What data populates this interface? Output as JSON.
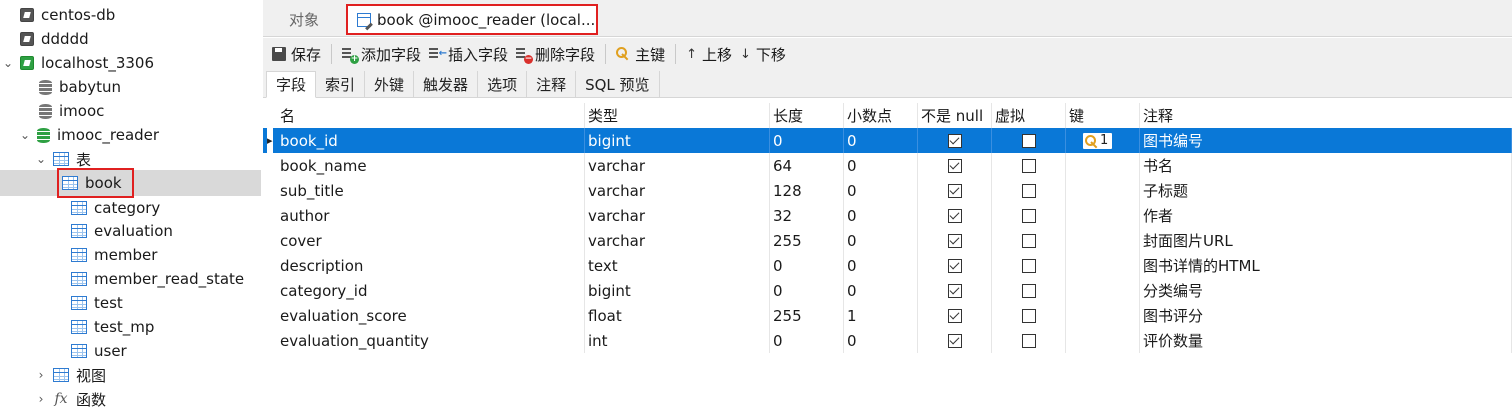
{
  "sidebar": {
    "items": [
      {
        "label": "centos-db",
        "icon": "connection-icon"
      },
      {
        "label": "ddddd",
        "icon": "connection-icon"
      },
      {
        "label": "localhost_3306",
        "icon": "connection-icon",
        "expanded": true
      },
      {
        "label": "babytun",
        "icon": "database-icon"
      },
      {
        "label": "imooc",
        "icon": "database-icon"
      },
      {
        "label": "imooc_reader",
        "icon": "database-icon",
        "expanded": true
      },
      {
        "label": "表",
        "icon": "tables-folder-icon",
        "expanded": true
      },
      {
        "label": "book",
        "icon": "table-icon",
        "selected": true
      },
      {
        "label": "category",
        "icon": "table-icon"
      },
      {
        "label": "evaluation",
        "icon": "table-icon"
      },
      {
        "label": "member",
        "icon": "table-icon"
      },
      {
        "label": "member_read_state",
        "icon": "table-icon"
      },
      {
        "label": "test",
        "icon": "table-icon"
      },
      {
        "label": "test_mp",
        "icon": "table-icon"
      },
      {
        "label": "user",
        "icon": "table-icon"
      },
      {
        "label": "视图",
        "icon": "views-folder-icon"
      },
      {
        "label": "函数",
        "icon": "functions-folder-icon"
      }
    ]
  },
  "tabs": {
    "objects": "对象",
    "active": "book @imooc_reader (local..."
  },
  "toolbar": {
    "save": "保存",
    "add_field": "添加字段",
    "insert_field": "插入字段",
    "delete_field": "删除字段",
    "primary_key": "主键",
    "move_up": "上移",
    "move_down": "下移"
  },
  "subtabs": [
    "字段",
    "索引",
    "外键",
    "触发器",
    "选项",
    "注释",
    "SQL 预览"
  ],
  "grid": {
    "columns": [
      "名",
      "类型",
      "长度",
      "小数点",
      "不是 null",
      "虚拟",
      "键",
      "注释"
    ],
    "key_badge": "1",
    "rows": [
      {
        "name": "book_id",
        "type": "bigint",
        "length": "0",
        "decimals": "0",
        "not_null": true,
        "virtual": false,
        "key": true,
        "comment": "图书编号"
      },
      {
        "name": "book_name",
        "type": "varchar",
        "length": "64",
        "decimals": "0",
        "not_null": true,
        "virtual": false,
        "key": false,
        "comment": "书名"
      },
      {
        "name": "sub_title",
        "type": "varchar",
        "length": "128",
        "decimals": "0",
        "not_null": true,
        "virtual": false,
        "key": false,
        "comment": "子标题"
      },
      {
        "name": "author",
        "type": "varchar",
        "length": "32",
        "decimals": "0",
        "not_null": true,
        "virtual": false,
        "key": false,
        "comment": "作者"
      },
      {
        "name": "cover",
        "type": "varchar",
        "length": "255",
        "decimals": "0",
        "not_null": true,
        "virtual": false,
        "key": false,
        "comment": "封面图片URL"
      },
      {
        "name": "description",
        "type": "text",
        "length": "0",
        "decimals": "0",
        "not_null": true,
        "virtual": false,
        "key": false,
        "comment": "图书详情的HTML"
      },
      {
        "name": "category_id",
        "type": "bigint",
        "length": "0",
        "decimals": "0",
        "not_null": true,
        "virtual": false,
        "key": false,
        "comment": "分类编号"
      },
      {
        "name": "evaluation_score",
        "type": "float",
        "length": "255",
        "decimals": "1",
        "not_null": true,
        "virtual": false,
        "key": false,
        "comment": "图书评分"
      },
      {
        "name": "evaluation_quantity",
        "type": "int",
        "length": "0",
        "decimals": "0",
        "not_null": true,
        "virtual": false,
        "key": false,
        "comment": "评价数量"
      }
    ]
  },
  "colors": {
    "selection": "#0a78d7",
    "highlight_border": "#e02020",
    "sidebar_selected": "#d9d9d9"
  }
}
